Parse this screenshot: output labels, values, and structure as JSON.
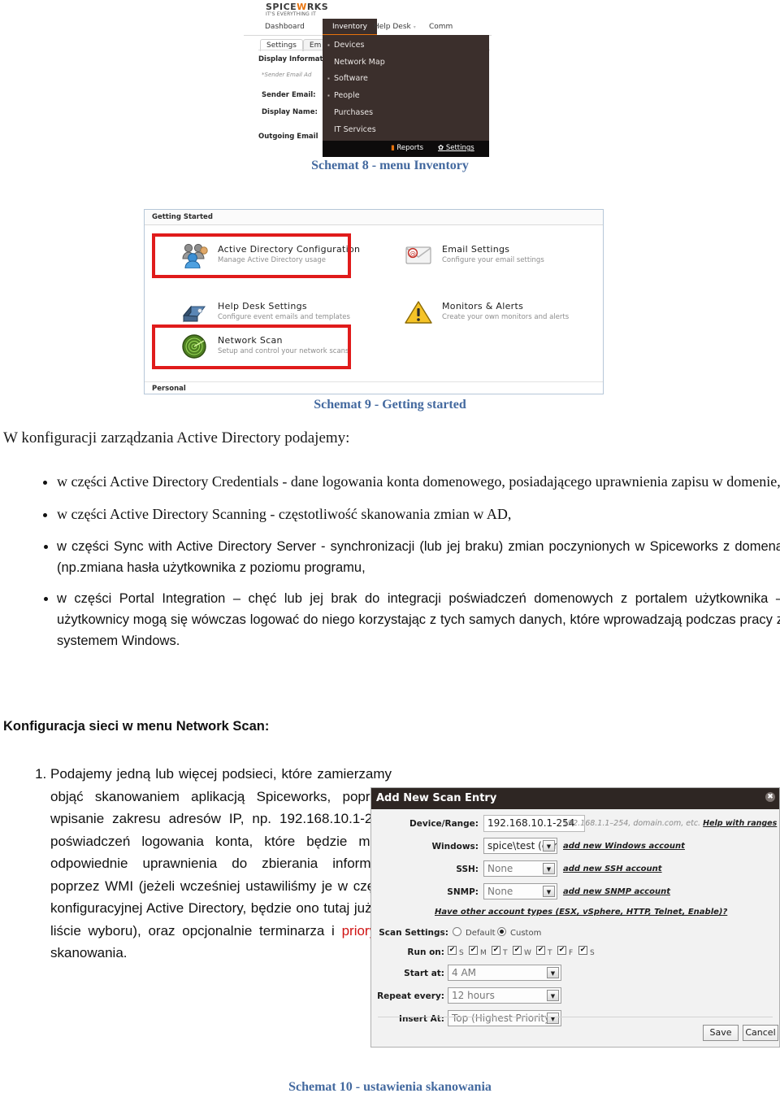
{
  "figure8": {
    "caption": "Schemat 8 - menu Inventory",
    "logo": {
      "part1": "SPICE",
      "part2": "W",
      "part3": "RKS",
      "tagline": "IT'S EVERYTHING IT"
    },
    "nav": [
      {
        "label": "Dashboard",
        "selected": false,
        "caret": false
      },
      {
        "label": "Inventory",
        "selected": true,
        "caret": false
      },
      {
        "label": "Help Desk",
        "selected": false,
        "caret": true
      },
      {
        "label": "Comm",
        "selected": false,
        "caret": false
      }
    ],
    "subtabs": [
      {
        "label": "Settings",
        "selected": true
      },
      {
        "label": "Em",
        "selected": false
      }
    ],
    "form": {
      "section": "Display Informat",
      "note": "*Sender Email Ad",
      "fields": [
        {
          "label": "Sender Email:"
        },
        {
          "label": "Display Name:"
        }
      ],
      "section2": "Outgoing Email"
    },
    "dropdown": {
      "items": [
        {
          "label": "Devices",
          "bullet": true
        },
        {
          "label": "Network Map",
          "bullet": false
        },
        {
          "label": "Software",
          "bullet": true
        },
        {
          "label": "People",
          "bullet": true
        },
        {
          "label": "Purchases",
          "bullet": false
        },
        {
          "label": "IT Services",
          "bullet": false
        }
      ],
      "footer": {
        "reports": "Reports",
        "settings": "Settings"
      }
    }
  },
  "figure9": {
    "caption": "Schemat 9 - Getting started",
    "header": "Getting Started",
    "footer_label": "Personal",
    "tiles": [
      {
        "title": "Active Directory Configuration",
        "subtitle": "Manage Active Directory usage",
        "icon": "people-icon",
        "highlighted": true
      },
      {
        "title": "Email Settings",
        "subtitle": "Configure your email settings",
        "icon": "envelope-icon",
        "highlighted": false
      },
      {
        "title": "Help Desk Settings",
        "subtitle": "Configure event emails and templates",
        "icon": "helpdesk-icon",
        "highlighted": false
      },
      {
        "title": "Monitors & Alerts",
        "subtitle": "Create your own monitors and alerts",
        "icon": "warning-triangle-icon",
        "highlighted": false
      },
      {
        "title": "Network Scan",
        "subtitle": "Setup and control your network scans",
        "icon": "radar-icon",
        "highlighted": true
      }
    ]
  },
  "body": {
    "intro": "W konfiguracji zarządzania Active Directory podajemy:",
    "bullets": [
      "w części Active Directory Credentials - dane logowania konta domenowego, posiadającego uprawnienia zapisu w domenie,",
      "w części Active Directory Scanning - częstotliwość skanowania zmian w AD,",
      "w części Sync with Active Directory Server - synchronizacji (lub jej braku) zmian poczynionych w Spiceworks z domeną (np.zmiana hasła użytkownika z poziomu programu,",
      "w części Portal Integration – chęć lub jej brak do integracji poświadczeń domenowych z portalem użytkownika – użytkownicy mogą się wówczas  logować do niego korzystając z tych samych danych, które wprowadzają podczas pracy z systemem Windows."
    ],
    "heading_network_scan": "Konfiguracja sieci w menu Network Scan:",
    "numbered_item_1_a": "Podajemy jedną lub więcej podsieci, które zamierzamy objąć skanowaniem aplikacją Spiceworks, poprzez wpisanie zakresu adresów IP, np. 192.168.10.1-254, poświadczeń logowania konta, które będzie miało odpowiednie uprawnienia do zbierania informacji poprzez WMI (jeżeli wcześniej ustawiliśmy je w części konfiguracyjnej Active Directory, będzie ono tutaj już na liście wyboru), oraz opcjonalnie terminarza i ",
    "numbered_item_1_hl": "priorytet",
    "numbered_item_1_b": " skanowania."
  },
  "figure10": {
    "caption": "Schemat 10 - ustawienia skanowania",
    "title": "Add New Scan Entry",
    "close_icon": "✖",
    "device_range": {
      "label": "Device/Range:",
      "value": "192.168.10.1-254",
      "hint_prefix": "192.168.1.1–254, domain.com, etc. ",
      "hint_link": "Help with ranges"
    },
    "windows": {
      "label": "Windows:",
      "value": "spice\\test    (current",
      "link": "add new Windows account"
    },
    "ssh": {
      "label": "SSH:",
      "value": "None",
      "link": "add new SSH account"
    },
    "snmp": {
      "label": "SNMP:",
      "value": "None",
      "link": "add new SNMP account"
    },
    "other_accounts_link": "Have other account types (ESX, vSphere, HTTP, Telnet, Enable)?",
    "scan_settings": {
      "label": "Scan Settings:",
      "options": [
        {
          "label": "Default",
          "selected": false
        },
        {
          "label": "Custom",
          "selected": true
        }
      ]
    },
    "run_on": {
      "label": "Run on:",
      "days": [
        {
          "label": "S",
          "checked": true
        },
        {
          "label": "M",
          "checked": true
        },
        {
          "label": "T",
          "checked": true
        },
        {
          "label": "W",
          "checked": true
        },
        {
          "label": "T",
          "checked": true
        },
        {
          "label": "F",
          "checked": true
        },
        {
          "label": "S",
          "checked": true
        }
      ]
    },
    "start_at": {
      "label": "Start at:",
      "value": "4 AM"
    },
    "repeat_every": {
      "label": "Repeat every:",
      "value": "12 hours"
    },
    "insert_at": {
      "label": "Insert At:",
      "value": "Top (Highest Priority)"
    },
    "save_label": "Save",
    "cancel_label": "Cancel"
  },
  "colors": {
    "caption_blue": "#43699f",
    "highlight_red": "#e01b1b",
    "accent_orange": "#e8730c",
    "dark_chrome": "#3b2f2c",
    "link_red": "#d01414"
  }
}
